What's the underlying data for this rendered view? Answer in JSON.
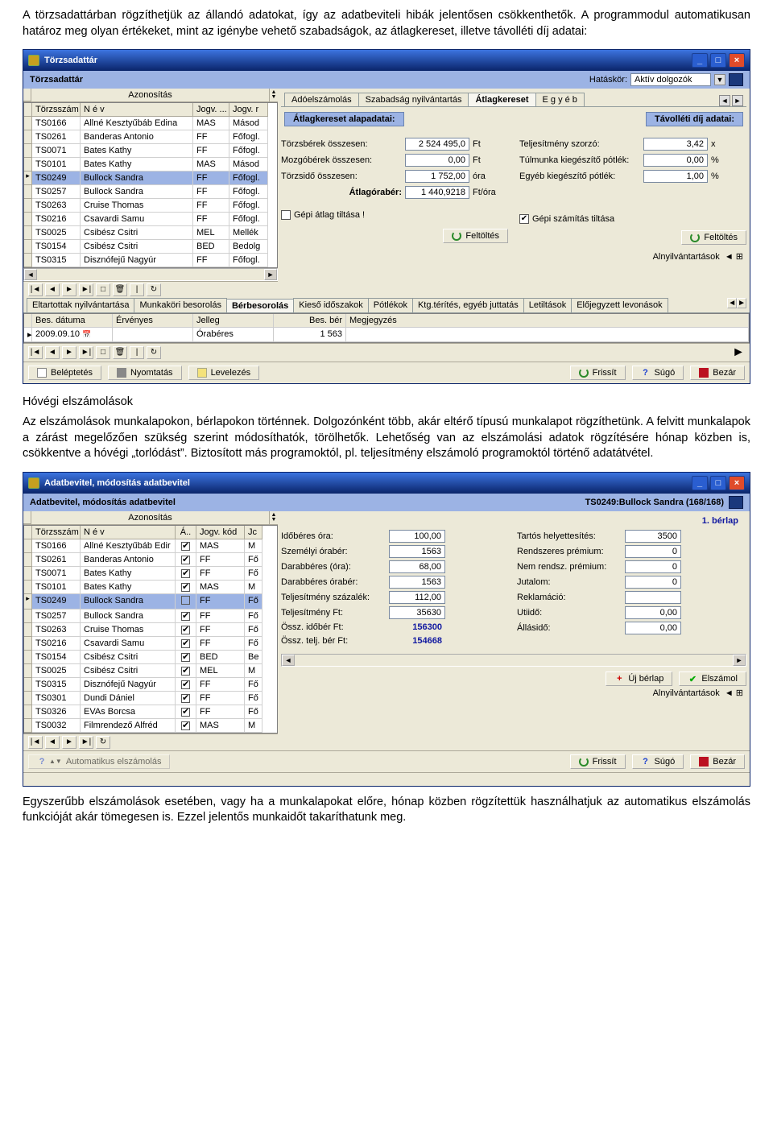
{
  "para1": "A törzsadattárban rögzíthetjük az állandó adatokat, így az adatbeviteli hibák jelentősen csökkenthetők. A programmodul automatikusan határoz meg olyan értékeket, mint az igénybe vehető szabadságok, az átlagkereset, illetve távolléti díj adatai:",
  "heading1": "Hóvégi elszámolások",
  "para2": "Az elszámolások munkalapokon, bérlapokon történnek. Dolgozónként több, akár eltérő típusú munkalapot rögzíthetünk. A felvitt munkalapok a zárást megelőzően szükség szerint módosíthatók, törölhetők. Lehetőség van az elszámolási adatok rögzítésére hónap közben is, csökkentve a hóvégi „torlódást”. Biztosított más programoktól, pl. teljesítmény elszámoló programoktól történő adatátvétel.",
  "para3": "Egyszerűbb elszámolások esetében, vagy ha a munkalapokat előre, hónap közben rögzítettük használhatjuk az automatikus elszámolás funkcióját akár tömegesen is. Ezzel jelentős munkaidőt takaríthatunk meg.",
  "win1": {
    "title": "Törzsadattár",
    "subtitle": "Törzsadattár",
    "scope_lbl": "Hatáskör:",
    "scope_val": "Aktív dolgozók",
    "grid": {
      "azon": "Azonosítás",
      "cols": [
        "Törzsszám",
        "N é v",
        "Jogv. ...",
        "Jogv. r"
      ],
      "rows": [
        [
          "TS0166",
          "Allné Kesztyűbáb Edina",
          "MAS",
          "Másod"
        ],
        [
          "TS0261",
          "Banderas Antonio",
          "FF",
          "Főfogl."
        ],
        [
          "TS0071",
          "Bates Kathy",
          "FF",
          "Főfogl."
        ],
        [
          "TS0101",
          "Bates Kathy",
          "MAS",
          "Másod"
        ],
        [
          "TS0249",
          "Bullock Sandra",
          "FF",
          "Főfogl."
        ],
        [
          "TS0257",
          "Bullock Sandra",
          "FF",
          "Főfogl."
        ],
        [
          "TS0263",
          "Cruise Thomas",
          "FF",
          "Főfogl."
        ],
        [
          "TS0216",
          "Csavardi Samu",
          "FF",
          "Főfogl."
        ],
        [
          "TS0025",
          "Csibész Csitri",
          "MEL",
          "Mellék"
        ],
        [
          "TS0154",
          "Csibész Csitri",
          "BED",
          "Bedolg"
        ],
        [
          "TS0315",
          "Disznófejű Nagyúr",
          "FF",
          "Főfogl."
        ]
      ],
      "selIdx": 4
    },
    "tabs_top": [
      "Adóelszámolás",
      "Szabadság nyilvántartás",
      "Átlagkereset",
      "E g y é b"
    ],
    "tabs_top_active": 2,
    "group_left": "Átlagkereset alapadatai:",
    "group_right": "Távolléti díj adatai:",
    "fld_torzs": "Törzsbérek összesen:",
    "fld_torzs_v": "2 524 495,0",
    "fld_torzs_u": "Ft",
    "fld_mozgo": "Mozgóbérek összesen:",
    "fld_mozgo_v": "0,00",
    "fld_mozgo_u": "Ft",
    "fld_tido": "Törzsidő összesen:",
    "fld_tido_v": "1 752,00",
    "fld_tido_u": "óra",
    "fld_atlag": "Átlagórabér:",
    "fld_atlag_v": "1 440,9218",
    "fld_atlag_u": "Ft/óra",
    "fld_telj": "Teljesítmény szorzó:",
    "fld_telj_v": "3,42",
    "fld_telj_u": "x",
    "fld_tul": "Túlmunka kiegészítő pótlék:",
    "fld_tul_v": "0,00",
    "fld_tul_u": "%",
    "fld_egy": "Egyéb kiegészítő pótlék:",
    "fld_egy_v": "1,00",
    "fld_egy_u": "%",
    "chk_left": "Gépi átlag tiltása !",
    "chk_right": "Gépi számítás tiltása",
    "btn_feltolt": "Feltöltés",
    "alnyilv": "Alnyilvántartások",
    "bottabs": [
      "Eltartottak nyilvántartása",
      "Munkaköri besorolás",
      "Bérbesorolás",
      "Kieső időszakok",
      "Pótlékok",
      "Ktg.térítés, egyéb juttatás",
      "Letiltások",
      "Előjegyzett levonások"
    ],
    "bottab_active": 2,
    "sg_cols": [
      "Bes. dátuma",
      "Érvényes",
      "Jelleg",
      "Bes. bér",
      "Megjegyzés"
    ],
    "sg_row": [
      "2009.09.10",
      "",
      "Órabéres",
      "1 563",
      ""
    ],
    "btns": {
      "bel": "Beléptetés",
      "nyom": "Nyomtatás",
      "lev": "Levelezés",
      "frissit": "Frissít",
      "sugo": "Súgó",
      "bezar": "Bezár"
    }
  },
  "win2": {
    "title": "Adatbevitel, módosítás adatbevitel",
    "sub_left": "Adatbevitel, módosítás adatbevitel",
    "sub_right": "TS0249:Bullock Sandra (168/168)",
    "grid": {
      "azon": "Azonosítás",
      "cols": [
        "Törzsszám",
        "N é v",
        "Á..",
        "Jogv. kód",
        "Jc"
      ],
      "rows": [
        [
          "TS0166",
          "Allné Kesztyűbáb Edir",
          "✔",
          "MAS",
          "M"
        ],
        [
          "TS0261",
          "Banderas Antonio",
          "✔",
          "FF",
          "Fő"
        ],
        [
          "TS0071",
          "Bates Kathy",
          "✔",
          "FF",
          "Fő"
        ],
        [
          "TS0101",
          "Bates Kathy",
          "✔",
          "MAS",
          "M"
        ],
        [
          "TS0249",
          "Bullock Sandra",
          "",
          "FF",
          "Fő"
        ],
        [
          "TS0257",
          "Bullock Sandra",
          "✔",
          "FF",
          "Fő"
        ],
        [
          "TS0263",
          "Cruise Thomas",
          "✔",
          "FF",
          "Fő"
        ],
        [
          "TS0216",
          "Csavardi Samu",
          "✔",
          "FF",
          "Fő"
        ],
        [
          "TS0154",
          "Csibész Csitri",
          "✔",
          "BED",
          "Be"
        ],
        [
          "TS0025",
          "Csibész Csitri",
          "✔",
          "MEL",
          "M"
        ],
        [
          "TS0315",
          "Disznófejű Nagyúr",
          "✔",
          "FF",
          "Fő"
        ],
        [
          "TS0301",
          "Dundi Dániel",
          "✔",
          "FF",
          "Fő"
        ],
        [
          "TS0326",
          "EVAs Borcsa",
          "✔",
          "FF",
          "Fő"
        ],
        [
          "TS0032",
          "Filmrendező Alfréd",
          "✔",
          "MAS",
          "M"
        ]
      ],
      "selIdx": 4
    },
    "berlap": "1. bérlap",
    "left": [
      [
        "Időbéres óra:",
        "100,00"
      ],
      [
        "Személyi órabér:",
        "1563"
      ],
      [
        "Darabbéres (óra):",
        "68,00"
      ],
      [
        "Darabbéres órabér:",
        "1563"
      ],
      [
        "Teljesítmény százalék:",
        "112,00"
      ],
      [
        "Teljesítmény Ft:",
        "35630"
      ],
      [
        "Össz. időbér Ft:",
        "156300"
      ],
      [
        "Össz. telj. bér Ft:",
        "154668"
      ]
    ],
    "right": [
      [
        "Tartós helyettesítés:",
        "3500"
      ],
      [
        "Rendszeres prémium:",
        "0"
      ],
      [
        "Nem rendsz. prémium:",
        "0"
      ],
      [
        "Jutalom:",
        "0"
      ],
      [
        "Reklamáció:",
        ""
      ],
      [
        "Utiidő:",
        "0,00"
      ],
      [
        "Állásidő:",
        "0,00"
      ]
    ],
    "btns": {
      "uj": "Új bérlap",
      "elszamol": "Elszámol",
      "frissit": "Frissít",
      "sugo": "Súgó",
      "bezar": "Bezár",
      "auto": "Automatikus elszámolás",
      "alnyilv": "Alnyilvántartások"
    }
  }
}
